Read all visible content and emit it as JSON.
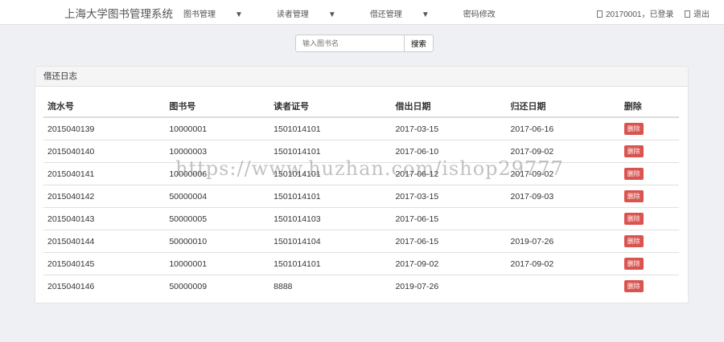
{
  "nav": {
    "brand": "上海大学图书管理系统",
    "menu": [
      {
        "label": "图书管理",
        "dropdown": true
      },
      {
        "label": "读者管理",
        "dropdown": true
      },
      {
        "label": "借还管理",
        "dropdown": true
      },
      {
        "label": "密码修改",
        "dropdown": false
      }
    ],
    "user": "20170001，已登录",
    "logout": "退出"
  },
  "search": {
    "placeholder": "输入图书名",
    "button": "搜索"
  },
  "panel": {
    "title": "借还日志",
    "columns": [
      "流水号",
      "图书号",
      "读者证号",
      "借出日期",
      "归还日期",
      "删除"
    ],
    "rows": [
      [
        "2015040139",
        "10000001",
        "1501014101",
        "2017-03-15",
        "2017-06-16"
      ],
      [
        "2015040140",
        "10000003",
        "1501014101",
        "2017-06-10",
        "2017-09-02"
      ],
      [
        "2015040141",
        "10000006",
        "1501014101",
        "2017-06-12",
        "2017-09-02"
      ],
      [
        "2015040142",
        "50000004",
        "1501014101",
        "2017-03-15",
        "2017-09-03"
      ],
      [
        "2015040143",
        "50000005",
        "1501014103",
        "2017-06-15",
        ""
      ],
      [
        "2015040144",
        "50000010",
        "1501014104",
        "2017-06-15",
        "2019-07-26"
      ],
      [
        "2015040145",
        "10000001",
        "1501014101",
        "2017-09-02",
        "2017-09-02"
      ],
      [
        "2015040146",
        "50000009",
        "8888",
        "2019-07-26",
        ""
      ]
    ],
    "delete_label": "删除"
  },
  "watermark": "https://www.huzhan.com/ishop29777"
}
